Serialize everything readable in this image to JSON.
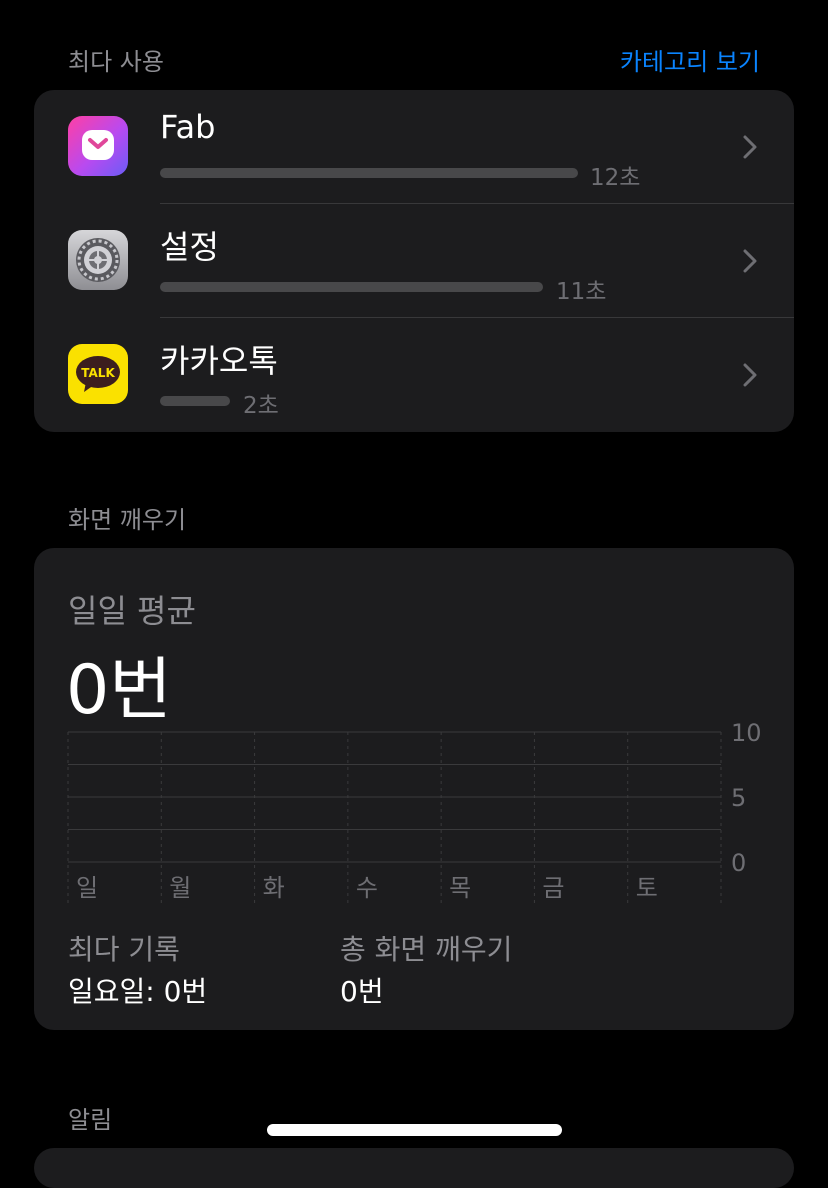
{
  "most_used": {
    "header": "최다 사용",
    "category_link": "카테고리 보기",
    "apps": [
      {
        "name": "Fab",
        "time": "12초",
        "seconds": 12,
        "icon": "fab-app-icon"
      },
      {
        "name": "설정",
        "time": "11초",
        "seconds": 11,
        "icon": "settings-gear-icon"
      },
      {
        "name": "카카오톡",
        "time": "2초",
        "seconds": 2,
        "icon": "kakaotalk-icon",
        "icon_text": "TALK"
      }
    ]
  },
  "pickups": {
    "header": "화면 깨우기",
    "daily_avg_label": "일일 평균",
    "daily_avg_value": "0번",
    "chart_data": {
      "type": "bar",
      "categories": [
        "일",
        "월",
        "화",
        "수",
        "목",
        "금",
        "토"
      ],
      "values": [
        0,
        0,
        0,
        0,
        0,
        0,
        0
      ],
      "y_ticks": [
        "10",
        "5",
        "0"
      ],
      "ylim": [
        0,
        10
      ],
      "title": "",
      "xlabel": "",
      "ylabel": ""
    },
    "stats": {
      "max_label": "최다 기록",
      "max_value": "일요일: 0번",
      "total_label": "총 화면 깨우기",
      "total_value": "0번"
    }
  },
  "notifications": {
    "header": "알림"
  },
  "colors": {
    "accent": "#0a84ff",
    "card_bg": "#1c1c1e",
    "bar": "#48484a",
    "secondary_text": "#8d8d92",
    "kakao_yellow": "#fae100"
  }
}
